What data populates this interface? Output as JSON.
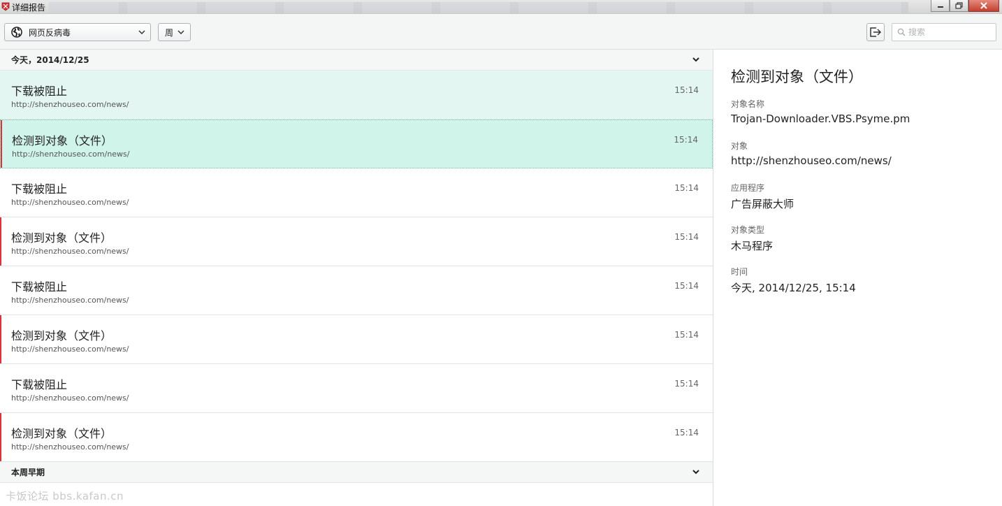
{
  "window": {
    "title": "详细报告"
  },
  "toolbar": {
    "component_value": "网页反病毒",
    "period_value": "周",
    "search_placeholder": "搜索"
  },
  "groups": [
    {
      "label": "今天，2014/12/25"
    },
    {
      "label": "本周早期"
    }
  ],
  "events": [
    {
      "title": "下载被阻止",
      "url": "http://shenzhouseo.com/news/",
      "time": "15:14"
    },
    {
      "title": "检测到对象（文件）",
      "url": "http://shenzhouseo.com/news/",
      "time": "15:14"
    },
    {
      "title": "下载被阻止",
      "url": "http://shenzhouseo.com/news/",
      "time": "15:14"
    },
    {
      "title": "检测到对象（文件）",
      "url": "http://shenzhouseo.com/news/",
      "time": "15:14"
    },
    {
      "title": "下载被阻止",
      "url": "http://shenzhouseo.com/news/",
      "time": "15:14"
    },
    {
      "title": "检测到对象（文件）",
      "url": "http://shenzhouseo.com/news/",
      "time": "15:14"
    },
    {
      "title": "下载被阻止",
      "url": "http://shenzhouseo.com/news/",
      "time": "15:14"
    },
    {
      "title": "检测到对象（文件）",
      "url": "http://shenzhouseo.com/news/",
      "time": "15:14"
    }
  ],
  "detail": {
    "title": "检测到对象（文件）",
    "fields": [
      {
        "label": "对象名称",
        "value": "Trojan-Downloader.VBS.Psyme.pm"
      },
      {
        "label": "对象",
        "value": "http://shenzhouseo.com/news/"
      },
      {
        "label": "应用程序",
        "value": "广告屏蔽大师"
      },
      {
        "label": "对象类型",
        "value": "木马程序"
      },
      {
        "label": "时间",
        "value": "今天, 2014/12/25, 15:14"
      }
    ]
  },
  "watermark": "卡饭论坛 bbs.kafan.cn",
  "colors": {
    "selected_bg": "#d0f3ea",
    "highlight_bg": "#e4f6f1",
    "threat_marker": "#e0303a"
  }
}
